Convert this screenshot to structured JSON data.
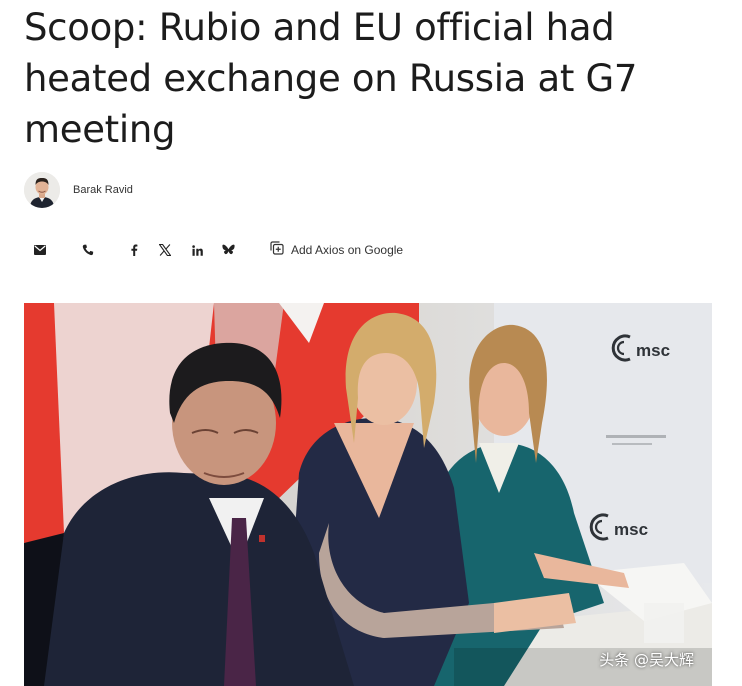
{
  "article": {
    "headline": "Scoop: Rubio and EU official had heated exchange on Russia at G7 meeting",
    "author": "Barak Ravid"
  },
  "share_bar": {
    "icons": [
      "email-icon",
      "phone-icon",
      "facebook-icon",
      "x-icon",
      "linkedin-icon",
      "bluesky-icon"
    ],
    "google_label": "Add Axios on Google"
  },
  "photo": {
    "sign_text_1": "msc",
    "sign_text_2": "msc",
    "watermark": "头条 @吴大辉"
  }
}
